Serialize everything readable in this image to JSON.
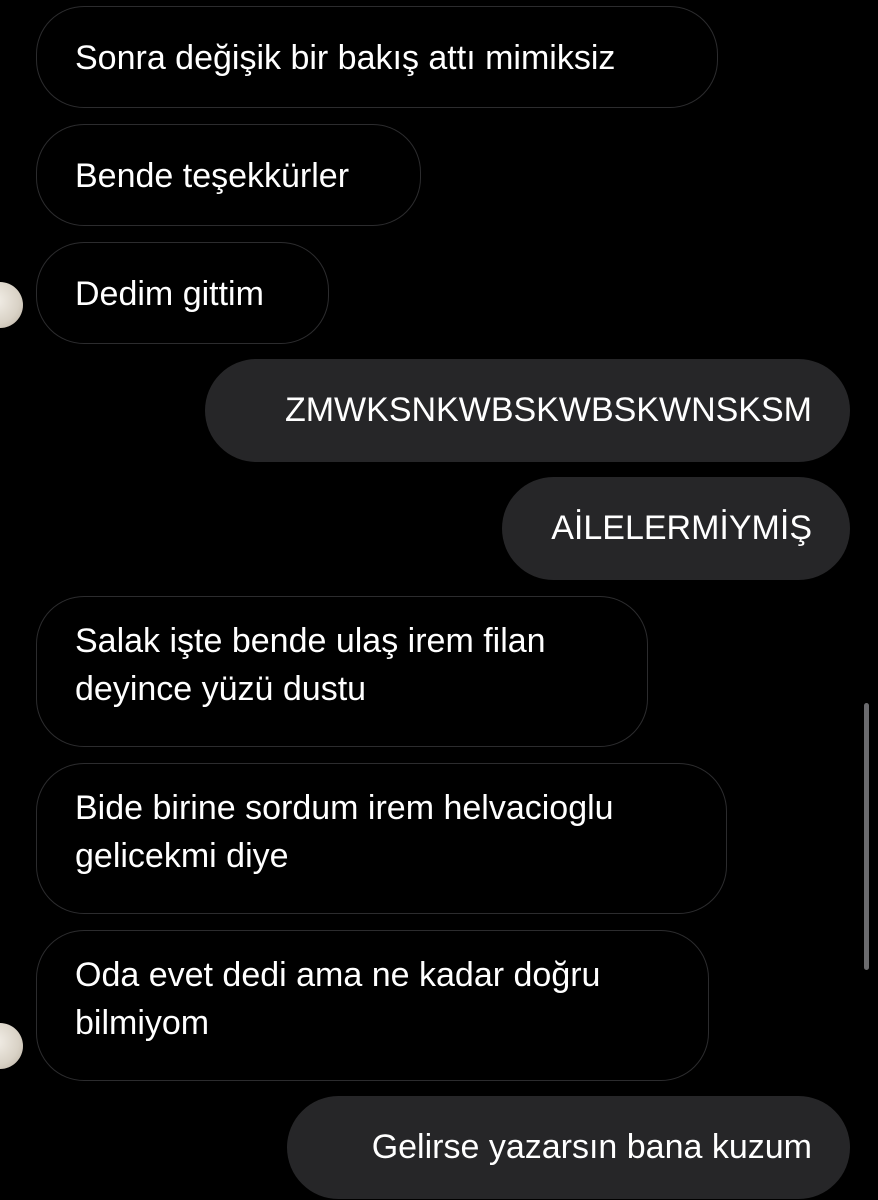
{
  "conversation": {
    "messages": [
      {
        "direction": "received",
        "text": "Sonra değişik bir bakış attı mimiksiz"
      },
      {
        "direction": "received",
        "text": "Bende teşekkürler"
      },
      {
        "direction": "received",
        "text": "Dedim gittim"
      },
      {
        "direction": "sent",
        "text": "ZMWKSNKWBSKWBSKWNSKSM"
      },
      {
        "direction": "sent",
        "text": "AİLELERMİYMİŞ"
      },
      {
        "direction": "received",
        "text": "Salak işte bende ulaş irem filan deyince yüzü dustu"
      },
      {
        "direction": "received",
        "text": "Bide birine sordum irem helvacioglu gelicekmi diye"
      },
      {
        "direction": "received",
        "text": "Oda evet dedi ama ne kadar doğru bilmiyom"
      },
      {
        "direction": "sent",
        "text": "Gelirse yazarsın bana kuzum"
      }
    ]
  },
  "colors": {
    "background": "#000000",
    "sent_bubble": "#262628",
    "received_border": "#2c2c2e",
    "text": "#ffffff",
    "scrollbar": "#6b6b6e"
  }
}
